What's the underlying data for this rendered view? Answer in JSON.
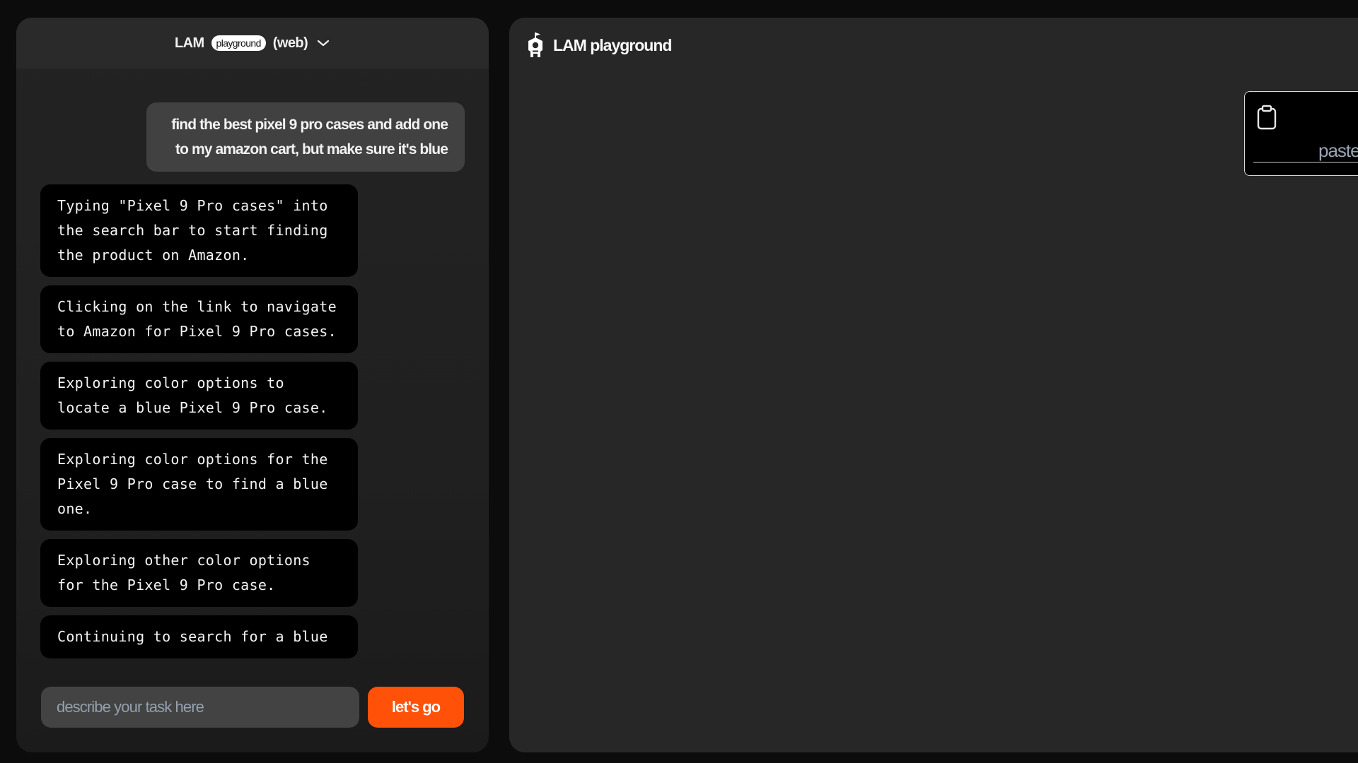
{
  "chat_panel": {
    "header": {
      "brand": "LAM",
      "pill": "playground",
      "mode": "(web)",
      "dropdown_icon": "chevron-down-icon"
    },
    "user_message": "find the best pixel 9 pro cases and add one to my amazon cart, but make sure it's blue",
    "steps": [
      "Typing \"Pixel 9 Pro cases\" into the search bar to start finding the product on Amazon.",
      "Clicking on the link to navigate to Amazon for Pixel 9 Pro cases.",
      "Exploring color options to locate a blue Pixel 9 Pro case.",
      "Exploring color options for the Pixel 9 Pro case to find a blue one.",
      "Exploring other color options for the Pixel 9 Pro case.",
      "Continuing to search for a blue"
    ],
    "composer": {
      "placeholder": "describe your task here",
      "value": "",
      "submit_label": "let's go"
    }
  },
  "view_panel": {
    "logo_icon": "castle-flag-icon",
    "title": "LAM playground",
    "paste_card": {
      "icon": "clipboard-icon",
      "label": "paste"
    }
  },
  "colors": {
    "accent": "#ff5108",
    "background": "#0c0c0c",
    "panel": "#232323",
    "panel_header": "#2a2a2a",
    "user_bubble": "#414141",
    "step_bubble": "#000000",
    "placeholder": "#95a0ad"
  }
}
